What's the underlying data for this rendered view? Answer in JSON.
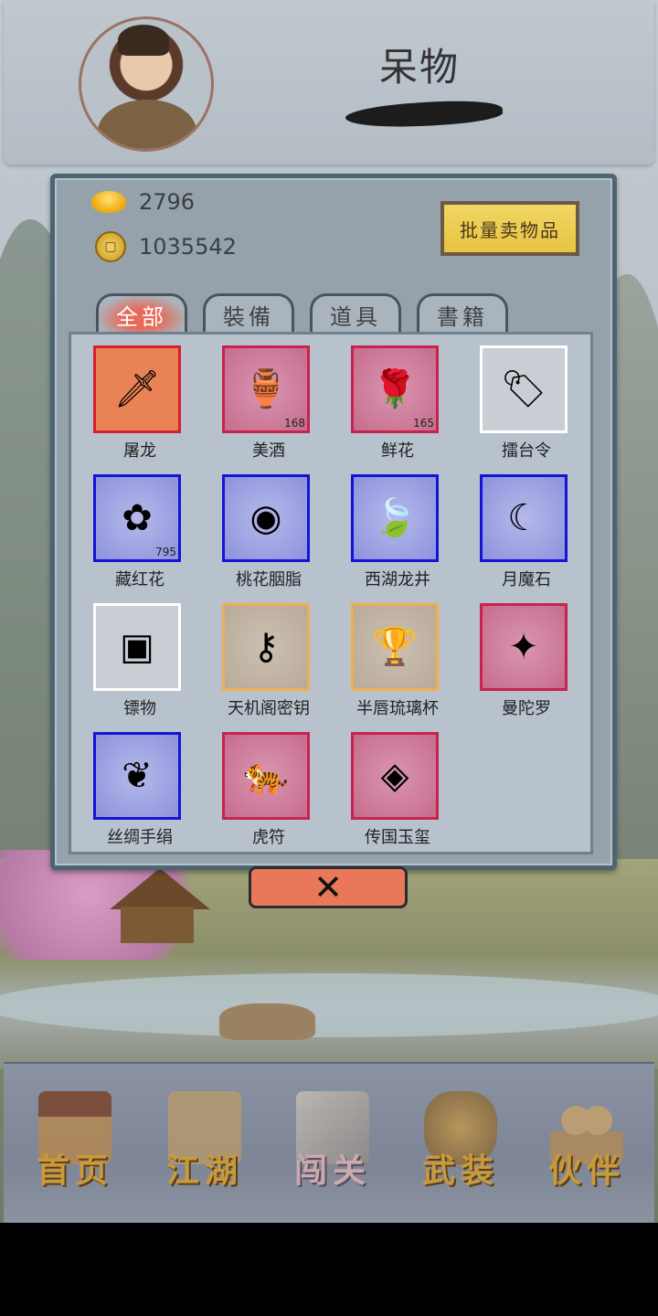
{
  "player": {
    "name": "呆物"
  },
  "currency": {
    "gold_ingot": "2796",
    "coins": "1035542"
  },
  "sell_button": "批量卖物品",
  "tabs": [
    {
      "label": "全部",
      "active": true
    },
    {
      "label": "裝備",
      "active": false
    },
    {
      "label": "道具",
      "active": false
    },
    {
      "label": "書籍",
      "active": false
    }
  ],
  "items": [
    {
      "name": "屠龙",
      "qty": "",
      "quality": "orange",
      "icon": "sword-icon"
    },
    {
      "name": "美酒",
      "qty": "168",
      "quality": "red",
      "icon": "wine-jar-icon"
    },
    {
      "name": "鲜花",
      "qty": "165",
      "quality": "red",
      "icon": "rose-icon"
    },
    {
      "name": "擂台令",
      "qty": "",
      "quality": "white",
      "icon": "token-icon"
    },
    {
      "name": "藏红花",
      "qty": "795",
      "quality": "blue",
      "icon": "flower-icon"
    },
    {
      "name": "桃花胭脂",
      "qty": "",
      "quality": "blue",
      "icon": "rouge-icon"
    },
    {
      "name": "西湖龙井",
      "qty": "",
      "quality": "blue",
      "icon": "tea-icon"
    },
    {
      "name": "月魔石",
      "qty": "",
      "quality": "blue",
      "icon": "moon-stone-icon"
    },
    {
      "name": "镖物",
      "qty": "",
      "quality": "white",
      "icon": "box-icon"
    },
    {
      "name": "天机阁密钥",
      "qty": "",
      "quality": "gold",
      "icon": "key-icon"
    },
    {
      "name": "半唇琉璃杯",
      "qty": "",
      "quality": "gold",
      "icon": "cup-icon"
    },
    {
      "name": "曼陀罗",
      "qty": "",
      "quality": "red",
      "icon": "crystal-flower-icon"
    },
    {
      "name": "丝绸手绢",
      "qty": "",
      "quality": "blue",
      "icon": "silk-icon"
    },
    {
      "name": "虎符",
      "qty": "",
      "quality": "red",
      "icon": "tiger-tally-icon"
    },
    {
      "name": "传国玉玺",
      "qty": "",
      "quality": "red",
      "icon": "jade-seal-icon"
    }
  ],
  "close_icon": "close-icon",
  "nav": [
    {
      "label": "首页",
      "icon": "house-icon",
      "active": false
    },
    {
      "label": "江湖",
      "icon": "scroll-icon",
      "active": false
    },
    {
      "label": "闯关",
      "icon": "crossed-swords-icon",
      "active": true
    },
    {
      "label": "武装",
      "icon": "armor-icon",
      "active": false
    },
    {
      "label": "伙伴",
      "icon": "companions-icon",
      "active": false
    }
  ],
  "colors": {
    "quality_orange": "#e98355",
    "quality_red": "#c8234e",
    "quality_blue": "#1414d8",
    "quality_gold": "#f0ad52",
    "quality_white": "#ffffff",
    "nav_text": "#c89a3c"
  }
}
